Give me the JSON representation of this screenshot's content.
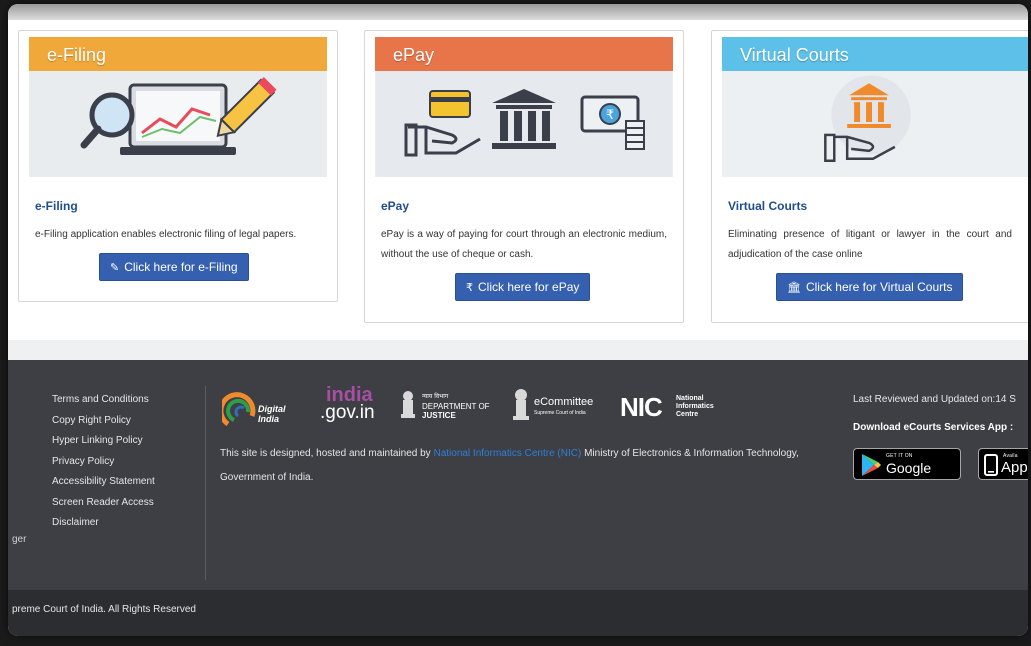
{
  "cards": [
    {
      "banner_label": "e-Filing",
      "banner_color": "#f0a83a",
      "title": "e-Filing",
      "description": "e-Filing application enables electronic filing of legal papers.",
      "button_label": "Click here for e-Filing",
      "button_icon": "edit-icon"
    },
    {
      "banner_label": "ePay",
      "banner_color": "#e8754a",
      "title": "ePay",
      "description": "ePay is a way of paying for court through an electronic medium, without the use of cheque or cash.",
      "button_label": "Click here for ePay",
      "button_icon": "rupee-icon"
    },
    {
      "banner_label": "Virtual Courts",
      "banner_color": "#5cc0e8",
      "title": "Virtual Courts",
      "description": "Eliminating presence of litigant or lawyer in the court and adjudication of the case online",
      "button_label": "Click here for Virtual Courts",
      "button_icon": "bank-icon"
    }
  ],
  "footer": {
    "links": [
      "Terms and Conditions",
      "Copy Right Policy",
      "Hyper Linking Policy",
      "Privacy Policy",
      "Accessibility Statement",
      "Screen Reader Access",
      "Disclaimer"
    ],
    "left_fragment": "ger",
    "logos": {
      "digital_india": "Digital India",
      "india_gov_top": "india",
      "india_gov_bottom": ".gov.in",
      "doj_hindi": "न्याय विभाग",
      "doj_line1": "DEPARTMENT OF",
      "doj_line2": "JUSTICE",
      "ecommittee": "eCommittee",
      "ecommittee_sub": "Supreme Court of India",
      "nic": "NIC",
      "nic_sub1": "National",
      "nic_sub2": "Informatics",
      "nic_sub3": "Centre"
    },
    "designed_prefix": "This site is designed, hosted and maintained by ",
    "designed_link": "National Informatics Centre (NIC)",
    "designed_suffix": " Ministry of Electronics & Information Technology, Government of India.",
    "last_reviewed": "Last Reviewed and Updated on:14 S",
    "download_label": "Download eCourts Services App :",
    "google_play_small": "GET IT ON",
    "google_play_big": "Google Play",
    "app_store_small": "Availa",
    "app_store_big": "App",
    "copyright": "preme Court of India. All Rights Reserved"
  },
  "colors": {
    "button": "#3560b0",
    "title_blue": "#1f4e8c",
    "footer_bg": "#3d3f44",
    "copyright_bg": "#2c2d31",
    "nic_link": "#2f7fd8"
  }
}
